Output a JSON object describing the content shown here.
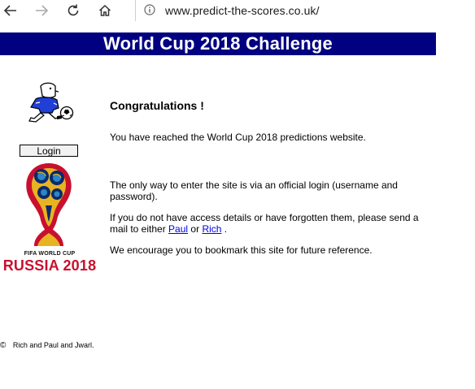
{
  "browser": {
    "url": "www.predict-the-scores.co.uk/"
  },
  "banner": {
    "title": "World Cup 2018 Challenge"
  },
  "sidebar": {
    "login_label": "Login",
    "logo_line1": "FIFA WORLD CUP",
    "logo_line2": "RUSSIA 2018"
  },
  "main": {
    "heading": "Congratulations !",
    "intro": "You have reached the World Cup 2018 predictions website.",
    "login_info": "The only way to enter the site is via an official login (username and password).",
    "access_prefix": "If you do not have access details or have forgotten them, please send a mail to either",
    "link_paul": "Paul",
    "access_or": "or",
    "link_rich": "Rich",
    "access_suffix": ".",
    "bookmark": "We encourage you to bookmark this site for future reference."
  },
  "footer": {
    "copyright_symbol": "©",
    "credits": "Rich and Paul and Jwarl."
  },
  "colors": {
    "banner_bg": "#000080",
    "link": "#0000ee"
  }
}
